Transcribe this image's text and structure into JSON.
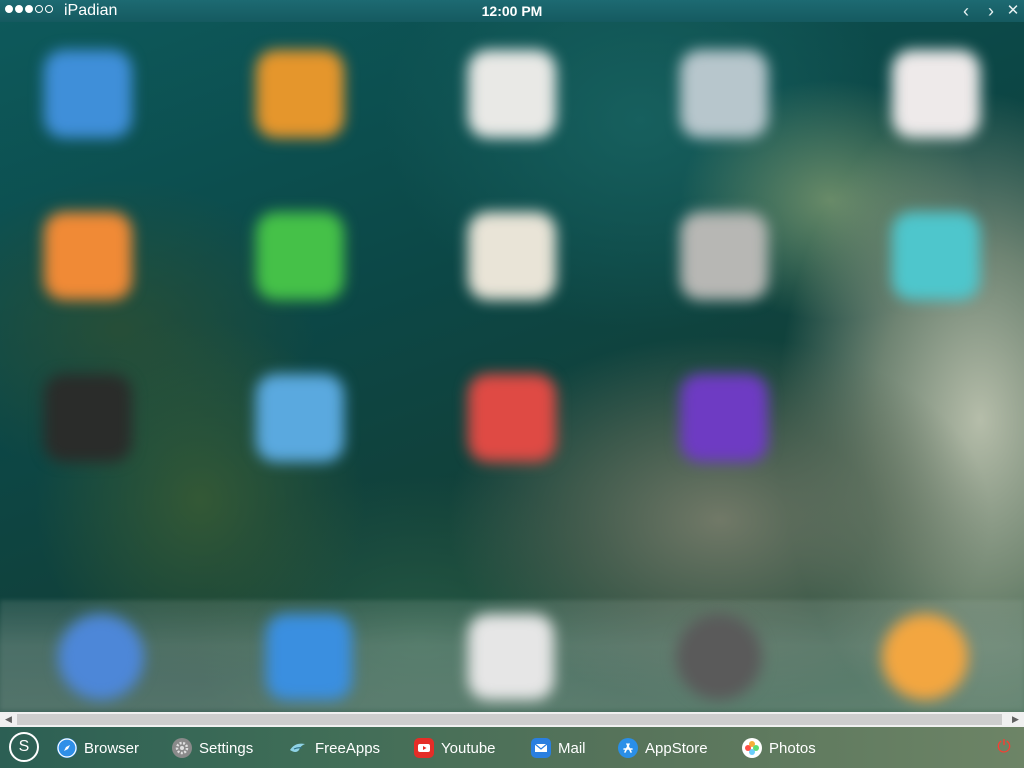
{
  "status_bar": {
    "signal_dots": [
      "full",
      "full",
      "full",
      "empty",
      "empty"
    ],
    "carrier": "iPadian",
    "time": "12:00 PM",
    "back_glyph": "‹",
    "forward_glyph": "›",
    "close_glyph": "✕"
  },
  "home_screen": {
    "icons": [
      {
        "name": "blue-app-icon",
        "color": "#3f8fd9"
      },
      {
        "name": "orange-app-icon",
        "color": "#e5962c"
      },
      {
        "name": "clock-app-icon",
        "color": "#e9e9e6"
      },
      {
        "name": "grey-app-icon",
        "color": "#b7c6cc"
      },
      {
        "name": "health-app-icon",
        "color": "#eeeaea"
      },
      {
        "name": "mail-orange-app-icon",
        "color": "#f08a36"
      },
      {
        "name": "messages-app-icon",
        "color": "#45c148"
      },
      {
        "name": "notes-app-icon",
        "color": "#e9e4d7"
      },
      {
        "name": "silver-app-icon",
        "color": "#b7b7b4"
      },
      {
        "name": "teal-app-icon",
        "color": "#4ec6cc"
      },
      {
        "name": "dark-app-icon",
        "color": "#2a2c2a"
      },
      {
        "name": "weather-app-icon",
        "color": "#5aa9df"
      },
      {
        "name": "video-app-icon",
        "color": "#df4a44"
      },
      {
        "name": "purple-app-icon",
        "color": "#6e3bc3"
      }
    ],
    "dock_icons": [
      {
        "name": "safari-app-icon",
        "color": "#4d87d8"
      },
      {
        "name": "mail-app-icon",
        "color": "#3a8fe0"
      },
      {
        "name": "calendar-app-icon",
        "color": "#e6e6e6"
      },
      {
        "name": "camera-app-icon",
        "color": "#5a5a5a"
      },
      {
        "name": "photos-app-icon",
        "color": "#f3a640"
      }
    ]
  },
  "scrollbar": {
    "left_glyph": "◀",
    "right_glyph": "▶"
  },
  "taskbar": {
    "start_glyph": "S",
    "items": [
      {
        "label": "Browser",
        "icon": "compass-icon",
        "color": "#2f8fe8"
      },
      {
        "label": "Settings",
        "icon": "gear-icon",
        "color": "#8a8a8a"
      },
      {
        "label": "FreeApps",
        "icon": "bird-icon",
        "color": "#3fa9c6"
      },
      {
        "label": "Youtube",
        "icon": "youtube-icon",
        "color": "#e52d27"
      },
      {
        "label": "Mail",
        "icon": "envelope-icon",
        "color": "#2a7fe0"
      },
      {
        "label": "AppStore",
        "icon": "appstore-icon",
        "color": "#2a8fe8"
      },
      {
        "label": "Photos",
        "icon": "photos-pinwheel-icon",
        "color": "#f5a623"
      }
    ],
    "power_glyph": "⏻"
  }
}
